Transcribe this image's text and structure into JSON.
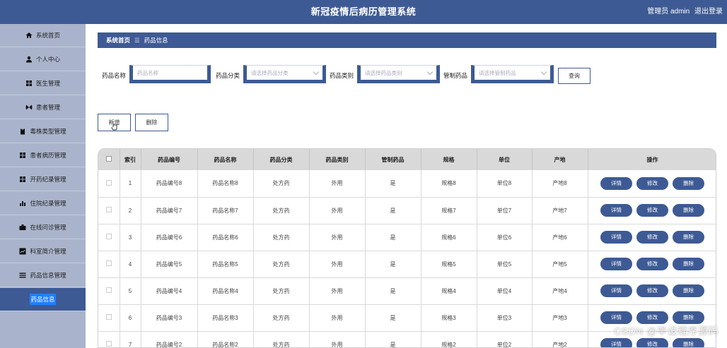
{
  "header": {
    "title": "新冠疫情后病历管理系统",
    "user_label": "管理员 admin",
    "logout_label": "退出登录"
  },
  "sidebar": {
    "items": [
      {
        "label": "系统首页",
        "icon": "home-icon"
      },
      {
        "label": "个人中心",
        "icon": "user-icon"
      },
      {
        "label": "医生管理",
        "icon": "grid-icon"
      },
      {
        "label": "患者管理",
        "icon": "butterfly-icon"
      },
      {
        "label": "毒株类型管理",
        "icon": "clipboard-icon"
      },
      {
        "label": "患者病历管理",
        "icon": "grid-icon"
      },
      {
        "label": "开药纪录管理",
        "icon": "grid-icon"
      },
      {
        "label": "住院纪录管理",
        "icon": "bar-chart-icon"
      },
      {
        "label": "在线问诊管理",
        "icon": "briefcase-icon"
      },
      {
        "label": "科室简介管理",
        "icon": "chart-box-icon"
      },
      {
        "label": "药品信息管理",
        "icon": "list-icon"
      },
      {
        "label": "药品信息",
        "icon": "",
        "active": true
      }
    ]
  },
  "breadcrumb": {
    "home": "系统首页",
    "separator": "☰",
    "current": "药品信息"
  },
  "filters": {
    "name_label": "药品名称",
    "name_placeholder": "药品名称",
    "category_label": "药品分类",
    "category_placeholder": "请选择药品分类",
    "type_label": "药品类别",
    "type_placeholder": "请选择药品类别",
    "controlled_label": "管制药品",
    "controlled_placeholder": "请选择管制药品",
    "search_button": "查询"
  },
  "actions": {
    "add_button": "新增",
    "delete_button": "删除"
  },
  "table": {
    "headers": [
      "",
      "索引",
      "药品编号",
      "药品名称",
      "药品分类",
      "药品类别",
      "管制药品",
      "规格",
      "单位",
      "产地",
      "操作"
    ],
    "op_labels": {
      "detail": "详情",
      "edit": "修改",
      "delete": "删除"
    },
    "rows": [
      {
        "index": "1",
        "code": "药品编号8",
        "name": "药品名称8",
        "category": "处方药",
        "type": "外用",
        "controlled": "是",
        "spec": "规格8",
        "unit": "单位8",
        "origin": "产地8"
      },
      {
        "index": "2",
        "code": "药品编号7",
        "name": "药品名称7",
        "category": "处方药",
        "type": "外用",
        "controlled": "是",
        "spec": "规格7",
        "unit": "单位7",
        "origin": "产地7"
      },
      {
        "index": "3",
        "code": "药品编号6",
        "name": "药品名称6",
        "category": "处方药",
        "type": "外用",
        "controlled": "是",
        "spec": "规格6",
        "unit": "单位6",
        "origin": "产地6"
      },
      {
        "index": "4",
        "code": "药品编号5",
        "name": "药品名称5",
        "category": "处方药",
        "type": "外用",
        "controlled": "是",
        "spec": "规格5",
        "unit": "单位5",
        "origin": "产地5"
      },
      {
        "index": "5",
        "code": "药品编号4",
        "name": "药品名称4",
        "category": "处方药",
        "type": "外用",
        "controlled": "是",
        "spec": "规格4",
        "unit": "单位4",
        "origin": "产地4"
      },
      {
        "index": "6",
        "code": "药品编号3",
        "name": "药品名称3",
        "category": "处方药",
        "type": "外用",
        "controlled": "是",
        "spec": "规格3",
        "unit": "单位3",
        "origin": "产地3"
      },
      {
        "index": "7",
        "code": "药品编号2",
        "name": "药品名称2",
        "category": "处方药",
        "type": "外用",
        "controlled": "是",
        "spec": "规格2",
        "unit": "单位2",
        "origin": "产地2"
      }
    ]
  },
  "watermark": "CSDN @毕设程序源码",
  "colors": {
    "primary": "#3d5a94",
    "sidebar": "#a9b4cc",
    "highlight": "#1e80ff"
  }
}
